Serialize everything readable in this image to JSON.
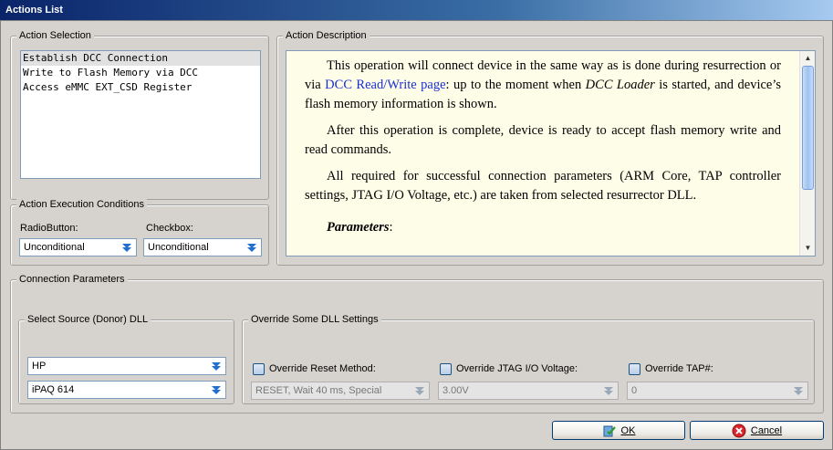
{
  "window": {
    "title": "Actions List"
  },
  "action_selection": {
    "label": "Action Selection",
    "items": [
      "Establish DCC Connection",
      "Write to Flash Memory via DCC",
      "Access eMMC EXT_CSD Register"
    ],
    "selected_index": 0
  },
  "execution_conditions": {
    "label": "Action Execution Conditions",
    "radio_label": "RadioButton:",
    "radio_value": "Unconditional",
    "checkbox_label": "Checkbox:",
    "checkbox_value": "Unconditional"
  },
  "description": {
    "label": "Action Description",
    "p1_a": "This operation will connect device in the same way as is done during resurrection or via ",
    "p1_link": "DCC Read/Write page",
    "p1_b": ": up to the moment when ",
    "p1_em": "DCC Loader",
    "p1_c": " is started, and device’s flash memory information is shown.",
    "p2": "After this operation is complete, device is ready to accept flash memory write and read commands.",
    "p3": "All required for successful connection parameters (ARM Core, TAP controller settings, JTAG I/O Voltage, etc.) are taken from selected resurrector DLL.",
    "p4": "Parameters",
    "p4_suffix": ":"
  },
  "connection_parameters": {
    "label": "Connection Parameters",
    "source_dll": {
      "label": "Select Source (Donor) DLL",
      "manufacturer": "HP",
      "model": "iPAQ 614"
    },
    "override": {
      "label": "Override Some DLL Settings",
      "reset_label": "Override Reset Method:",
      "reset_value": "RESET, Wait 40 ms, Special",
      "jtag_label": "Override JTAG I/O Voltage:",
      "jtag_value": "3.00V",
      "tap_label": "Override TAP#:",
      "tap_value": "0"
    }
  },
  "buttons": {
    "ok_label": "OK",
    "cancel_label": "Cancel"
  },
  "colors": {
    "title_bar": "#0a246a",
    "link": "#1a2fd0",
    "description_bg": "#fefde8",
    "window_bg": "#d6d3ce"
  }
}
